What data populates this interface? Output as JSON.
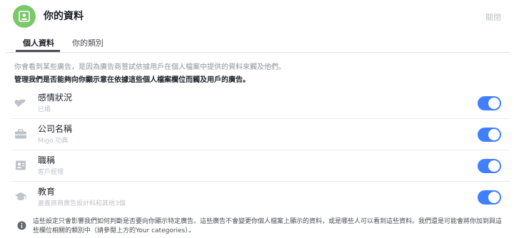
{
  "header": {
    "title": "你的資料",
    "close_label": "關閉"
  },
  "tabs": [
    {
      "label": "個人資料",
      "active": true
    },
    {
      "label": "你的類別",
      "active": false
    }
  ],
  "intro": {
    "text": "你會看到某些廣告，是因為廣告商嘗試依據用戶在個人檔案中提供的資料來觸及他們。",
    "bold": "管理我們是否能夠向你顯示意在依據這些個人檔案欄位而觸及用戶的廣告。"
  },
  "rows": [
    {
      "title": "感情狀況",
      "sub": "已婚",
      "icon": "hearts-icon",
      "enabled": true
    },
    {
      "title": "公司名稱",
      "sub": "Migo 功典",
      "icon": "briefcase-icon",
      "enabled": true
    },
    {
      "title": "職稱",
      "sub": "客戶經理",
      "icon": "id-badge-icon",
      "enabled": true
    },
    {
      "title": "教育",
      "sub": "嘉義商商廣告設計科和其他3個",
      "icon": "graduation-cap-icon",
      "enabled": true
    }
  ],
  "footer": {
    "text": "這些設定只會影響我們如何判斷是否要向你顯示特定廣告。這些廣告不會變更你個人檔案上顯示的資料，或是哪些人可以看到這些資料。我們還是可能會將你加到與這些欄位相關的類別中（請參閱上方的Your categories）。"
  },
  "colors": {
    "accent": "#4080ff",
    "header_icon_bg": "#7bc86c"
  }
}
